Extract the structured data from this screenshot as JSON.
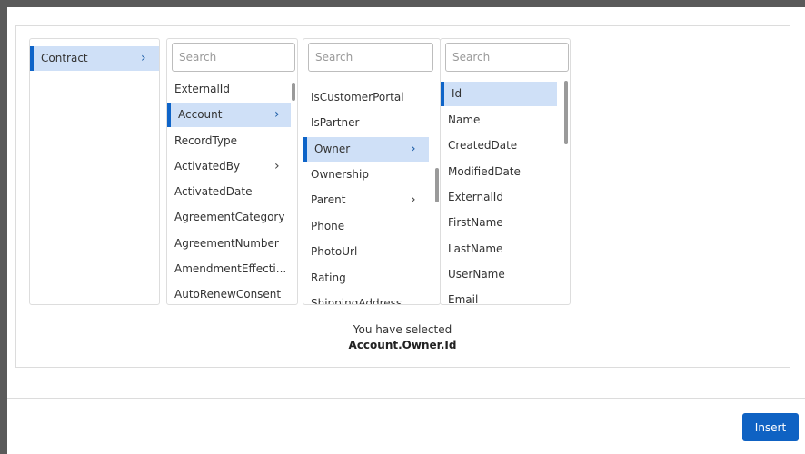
{
  "columns": [
    {
      "items": [
        {
          "label": "Contract",
          "chevron": "›",
          "selected": true
        }
      ]
    },
    {
      "search_placeholder": "Search",
      "items": [
        {
          "label": "ExternalId"
        },
        {
          "label": "Account",
          "chevron": "›",
          "selected": true
        },
        {
          "label": "RecordType"
        },
        {
          "label": "ActivatedBy",
          "chevron": "›"
        },
        {
          "label": "ActivatedDate"
        },
        {
          "label": "AgreementCategory"
        },
        {
          "label": "AgreementNumber"
        },
        {
          "label": "AmendmentEffecti..."
        },
        {
          "label": "AutoRenewConsent"
        }
      ]
    },
    {
      "search_placeholder": "Search",
      "items": [
        {
          "label": "IsCustomerPortal"
        },
        {
          "label": "IsPartner"
        },
        {
          "label": "Owner",
          "chevron": "›",
          "selected": true
        },
        {
          "label": "Ownership"
        },
        {
          "label": "Parent",
          "chevron": "›"
        },
        {
          "label": "Phone"
        },
        {
          "label": "PhotoUrl"
        },
        {
          "label": "Rating"
        },
        {
          "label": "ShippingAddress"
        }
      ]
    },
    {
      "search_placeholder": "Search",
      "items": [
        {
          "label": "Id",
          "selected": true
        },
        {
          "label": "Name"
        },
        {
          "label": "CreatedDate"
        },
        {
          "label": "ModifiedDate"
        },
        {
          "label": "ExternalId"
        },
        {
          "label": "FirstName"
        },
        {
          "label": "LastName"
        },
        {
          "label": "UserName"
        },
        {
          "label": "Email"
        }
      ]
    }
  ],
  "selection": {
    "caption": "You have selected",
    "path": "Account.Owner.Id"
  },
  "footer": {
    "insert_label": "Insert"
  },
  "colors": {
    "accent": "#0f62c3",
    "selected_bg": "#cfe0f7"
  }
}
